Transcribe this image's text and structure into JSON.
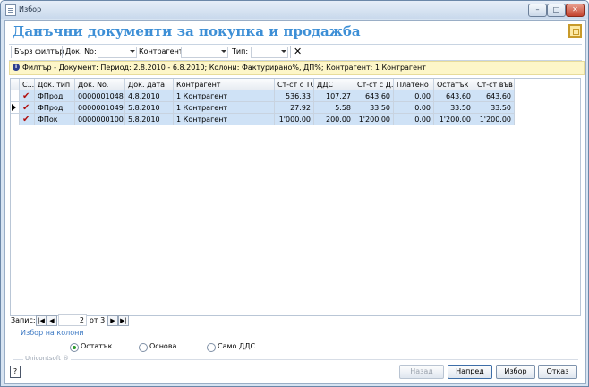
{
  "window": {
    "title": "Избор"
  },
  "header": {
    "title": "Данъчни документи за покупка и продажба"
  },
  "filterbar": {
    "quick_filter": "Бърз филтър",
    "doc_no_label": "Док. No:",
    "counterparty_label": "Контрагент:",
    "type_label": "Тип:"
  },
  "info": {
    "text": "Филтър - Документ: Период: 2.8.2010 - 6.8.2010; Колони: Фактурирано%, ДП%; Контрагент: 1 Контрагент"
  },
  "table": {
    "headers": [
      "С...",
      "Док. тип",
      "Док. No.",
      "Док. дата",
      "Контрагент",
      "Ст-ст с ТО",
      "ДДС",
      "Ст-ст с Д...",
      "Платено",
      "Остатък",
      "Ст-ст във ..."
    ],
    "rows": [
      {
        "check": "✔",
        "type": "ФПрод",
        "no": "0000001048",
        "date": "4.8.2010",
        "counterparty": "1 Контрагент",
        "value": "536.33",
        "vat": "107.27",
        "total": "643.60",
        "paid": "0.00",
        "rest": "643.60",
        "other": "643.60"
      },
      {
        "check": "✔",
        "type": "ФПрод",
        "no": "0000001049",
        "date": "5.8.2010",
        "counterparty": "1 Контрагент",
        "value": "27.92",
        "vat": "5.58",
        "total": "33.50",
        "paid": "0.00",
        "rest": "33.50",
        "other": "33.50"
      },
      {
        "check": "✔",
        "type": "ФПок",
        "no": "0000000100",
        "date": "5.8.2010",
        "counterparty": "1 Контрагент",
        "value": "1'000.00",
        "vat": "200.00",
        "total": "1'200.00",
        "paid": "0.00",
        "rest": "1'200.00",
        "other": "1'200.00"
      }
    ]
  },
  "nav": {
    "label": "Запис:",
    "current": "2",
    "of_label": "от 3"
  },
  "column_select": "Избор на колони",
  "options": {
    "items": [
      "Остатък",
      "Основа",
      "Само ДДС"
    ],
    "selected": 0
  },
  "brand": "Unicontsoft ®",
  "buttons": {
    "back": "Назад",
    "next": "Напред",
    "choose": "Избор",
    "cancel": "Отказ"
  }
}
